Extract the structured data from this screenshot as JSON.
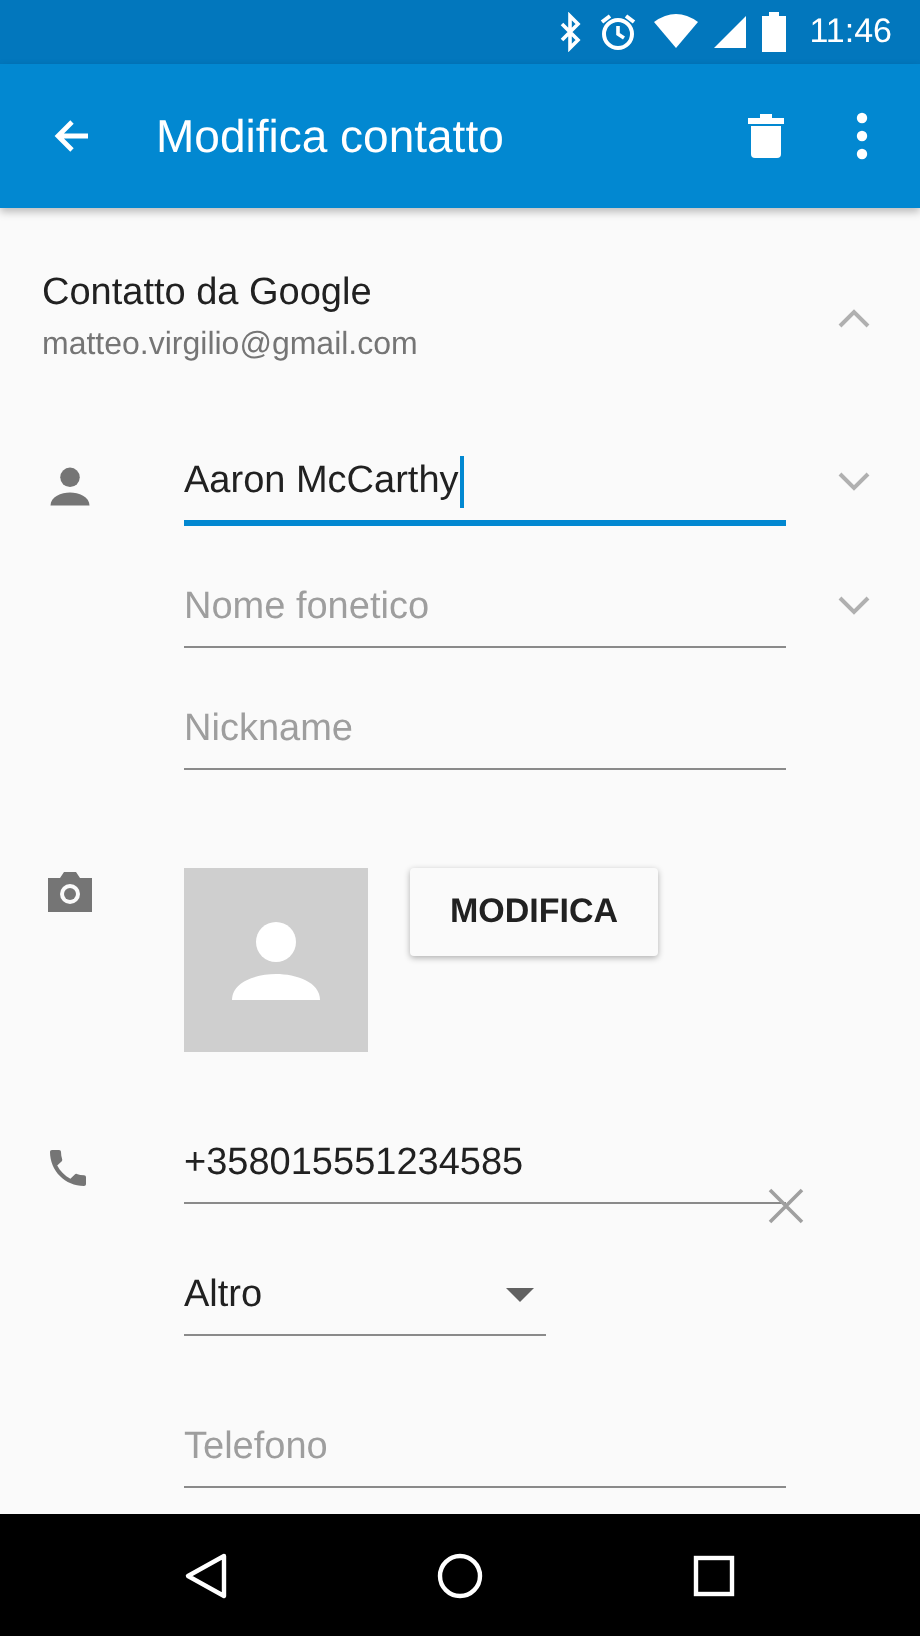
{
  "status_bar": {
    "time": "11:46"
  },
  "app_bar": {
    "title": "Modifica contatto"
  },
  "account": {
    "title": "Contatto da Google",
    "email": "matteo.virgilio@gmail.com",
    "expanded": true
  },
  "name_fields": [
    {
      "kind": "value",
      "text": "Aaron McCarthy",
      "focused": true,
      "expandable": true
    },
    {
      "kind": "placeholder",
      "text": "Nome fonetico",
      "focused": false,
      "expandable": true
    },
    {
      "kind": "placeholder",
      "text": "Nickname",
      "focused": false,
      "expandable": false
    }
  ],
  "photo": {
    "button": "MODIFICA"
  },
  "phone": {
    "number": "+358015551234585",
    "type": "Altro",
    "new_placeholder": "Telefono"
  }
}
